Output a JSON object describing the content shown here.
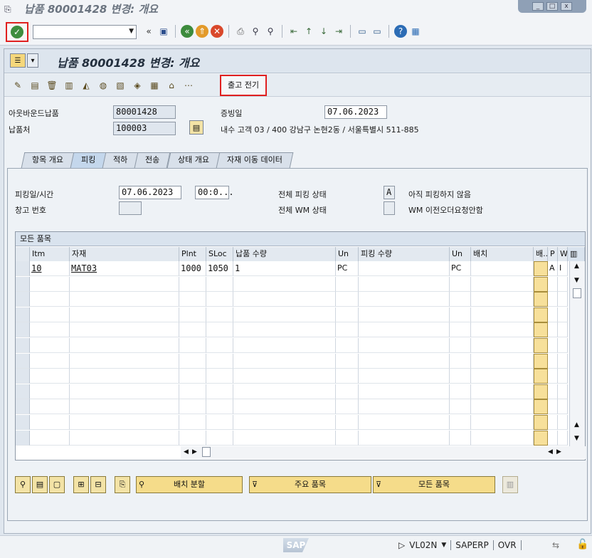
{
  "window": {
    "title": "납품 80001428 변경: 개요",
    "controls": [
      "_",
      "□",
      "x"
    ]
  },
  "system_toolbar": {
    "command_field_value": "",
    "icons": [
      "enter-icon",
      "back-icon",
      "save-icon",
      "back-green-icon",
      "exit-icon",
      "cancel-icon",
      "print-icon",
      "find-icon",
      "find-next-icon",
      "first-page-icon",
      "prev-page-icon",
      "next-page-icon",
      "last-page-icon",
      "new-session-icon",
      "shortcut-icon",
      "help-icon",
      "customize-icon"
    ]
  },
  "app": {
    "title": "납품 80001428 변경: 개요",
    "post_goods_issue_label": "출고 전기"
  },
  "header": {
    "outbound_delivery_label": "아웃바운드납품",
    "outbound_delivery_value": "80001428",
    "ship_to_label": "납품처",
    "ship_to_value": "100003",
    "doc_date_label": "증빙일",
    "doc_date_value": "07.06.2023",
    "address_text": "내수 고객 03 / 400 강남구 논현2동 / 서울특별시 511-885"
  },
  "tabs": [
    "항목 개요",
    "피킹",
    "적하",
    "전송",
    "상태 개요",
    "자재 이동 데이터"
  ],
  "active_tab": 1,
  "picking": {
    "pick_date_label": "피킹일/시간",
    "pick_date_value": "07.06.2023",
    "pick_time_value": "00:0...",
    "warehouse_no_label": "창고 번호",
    "warehouse_no_value": "",
    "overall_pick_status_label": "전체 피킹 상태",
    "overall_pick_status_value": "A",
    "overall_pick_status_text": "아직 피킹하지 않음",
    "overall_wm_status_label": "전체 WM 상태",
    "overall_wm_status_value": "",
    "overall_wm_status_text": "WM 이전오더요청안함"
  },
  "items_table": {
    "caption": "모든 품목",
    "columns": [
      "Itm",
      "자재",
      "Plnt",
      "SLoc",
      "납품 수량",
      "Un",
      "피킹 수량",
      "Un",
      "배치",
      "배..",
      "P",
      "W"
    ],
    "rows": [
      {
        "itm": "10",
        "material": "MAT03",
        "plnt": "1000",
        "sloc": "1050",
        "dlv_qty": "1",
        "un": "PC",
        "pick_qty": "",
        "un2": "PC",
        "batch": "",
        "p": "A",
        "w": "I"
      }
    ]
  },
  "bottom_buttons": {
    "batch_split": "배치 분할",
    "main_items": "주요 품목",
    "all_items": "모든 품목"
  },
  "status_bar": {
    "transaction": "VL02N",
    "system": "SAPERP",
    "mode": "OVR",
    "logo": "SAP"
  }
}
